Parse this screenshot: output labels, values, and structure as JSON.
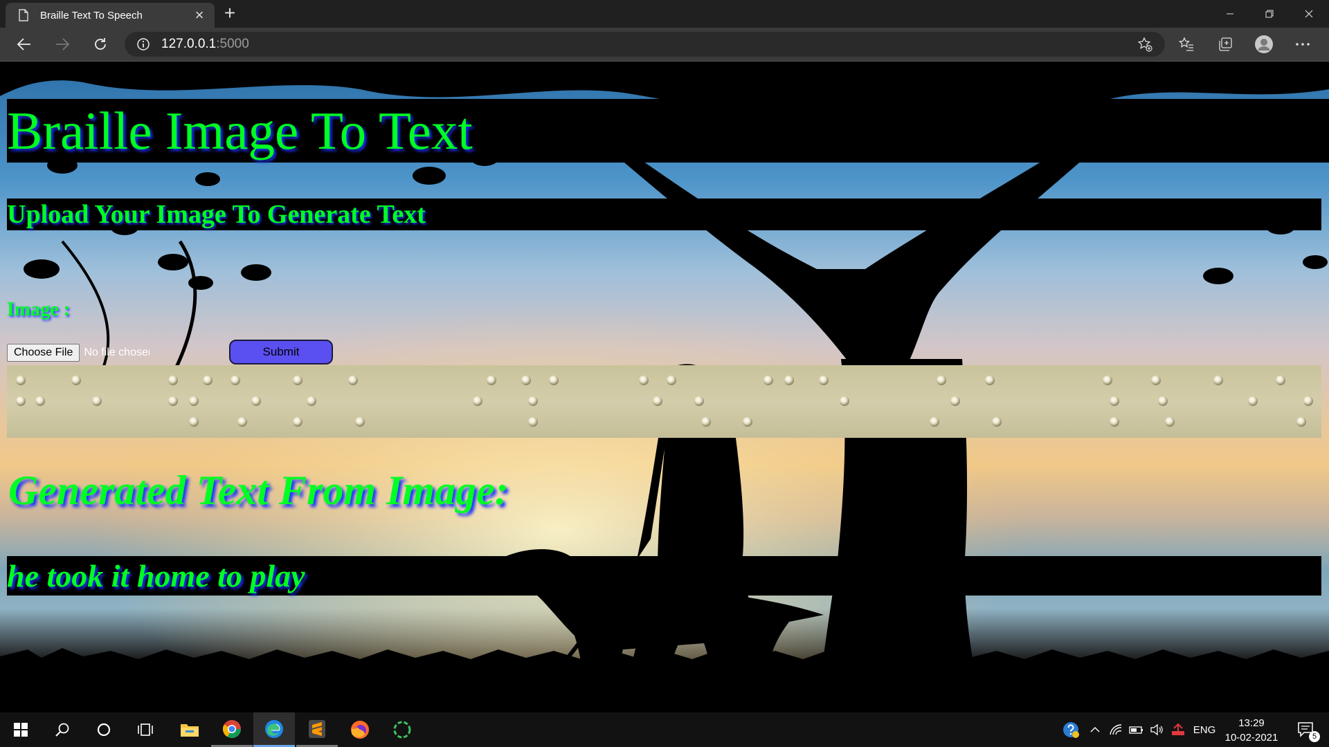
{
  "browser": {
    "tab_title": "Braille Text To Speech",
    "url_host": "127.0.0.1",
    "url_port": ":5000"
  },
  "page": {
    "main_heading": "Braille Image To Text",
    "sub_heading": "Upload Your Image To Generate Text",
    "image_label": "Image :",
    "choose_file_label": "Choose File",
    "file_status": "No file chosen",
    "submit_label": "Submit",
    "generated_heading": "Generated Text From Image:",
    "generated_text": "he took it home to play"
  },
  "taskbar": {
    "apps": [
      "start-icon",
      "search-icon",
      "cortana-icon",
      "task-view-icon",
      "file-explorer-icon",
      "chrome-icon",
      "edge-icon",
      "sublime-text-icon",
      "firefox-icon",
      "app-icon"
    ],
    "language": "ENG",
    "time": "13:29",
    "date": "10-02-2021",
    "notification_count": "5"
  },
  "colors": {
    "heading_green": "#00ff22",
    "heading_shadow": "#1d33ff",
    "submit_button": "#5a4ff0"
  }
}
